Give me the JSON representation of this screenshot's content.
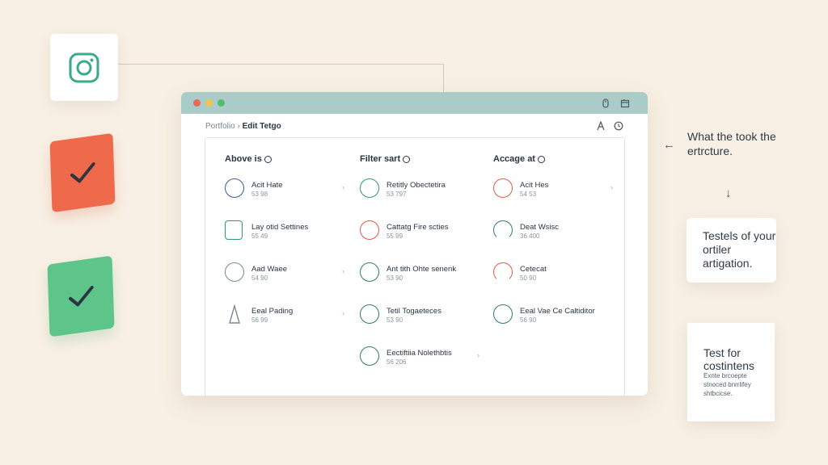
{
  "window": {
    "breadcrumb_prefix": "Portfolio ›",
    "breadcrumb_current": "Edit Tetgo"
  },
  "columns": [
    {
      "heading": "Above is",
      "items": [
        {
          "title": "Acit Hate",
          "sub": "53 98",
          "color": "#3c5a8a",
          "shape": "circle"
        },
        {
          "title": "Lay otid Settines",
          "sub": "55 49",
          "color": "#2f9a6c",
          "shape": "square"
        },
        {
          "title": "Aad Waee",
          "sub": "54 90",
          "color": "#7b8794",
          "shape": "circle"
        },
        {
          "title": "Eeal Pading",
          "sub": "56 99",
          "color": "#7b8794",
          "shape": "triangle"
        }
      ]
    },
    {
      "heading": "Filter sart",
      "items": [
        {
          "title": "Retitly Obectetira",
          "sub": "53 797",
          "color": "#2f9a6c",
          "shape": "circle"
        },
        {
          "title": "Cattatg Fire scties",
          "sub": "55 99",
          "color": "#e05a48",
          "shape": "circle"
        },
        {
          "title": "Ant tith Ohte senenk",
          "sub": "53 90",
          "color": "#2f7a70",
          "shape": "circle"
        },
        {
          "title": "Tetil Togaeteces",
          "sub": "53 90",
          "color": "#2f7a70",
          "shape": "circle"
        },
        {
          "title": "Eectiftiia Nolethbtis",
          "sub": "56 206",
          "color": "#2f7a70",
          "shape": "circle"
        }
      ]
    },
    {
      "heading": "Accage at",
      "items": [
        {
          "title": "Acit Hes",
          "sub": "54 53",
          "color": "#e05a48",
          "shape": "circle"
        },
        {
          "title": "Deat Wsisc",
          "sub": "36 400",
          "color": "#2f7a70",
          "shape": "circle"
        },
        {
          "title": "Cetecat",
          "sub": "50 90",
          "color": "#e05a48",
          "shape": "circle"
        },
        {
          "title": "Eeal Vae Ce Caltiditor",
          "sub": "56 90",
          "color": "#2f7a70",
          "shape": "circle"
        }
      ]
    }
  ],
  "side": {
    "arrow_text": "What the took the ertrcture.",
    "card_a_text": "Testels of your ortiler artigation.",
    "card_b_title": "Test for costintens",
    "card_b_small": "Exnte brcoepte stnoced bnrrlifey shtbcicse."
  },
  "colors": {
    "background": "#f8f0e4",
    "accent_red": "#ef6a4a",
    "accent_green": "#5dc48a",
    "titlebar": "#a9ccc8"
  }
}
